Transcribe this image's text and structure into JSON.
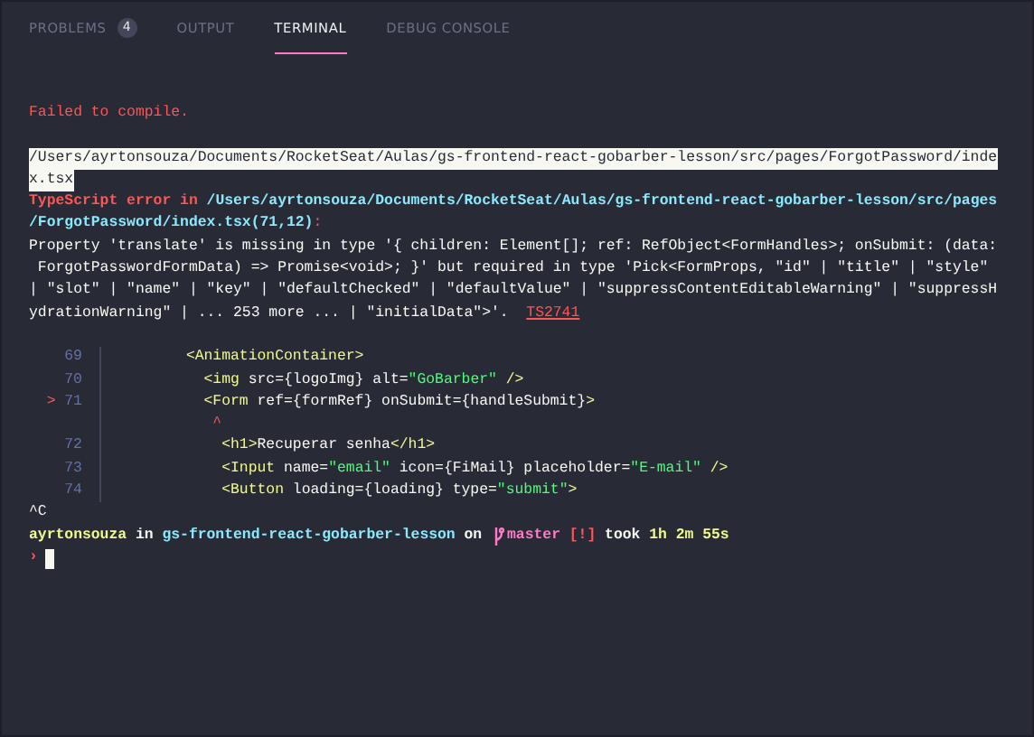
{
  "tabs": [
    {
      "label": "PROBLEMS",
      "badge": "4",
      "selected": false
    },
    {
      "label": "OUTPUT",
      "selected": false
    },
    {
      "label": "TERMINAL",
      "selected": true
    },
    {
      "label": "DEBUG CONSOLE",
      "selected": false
    }
  ],
  "terminal": {
    "lines": [
      {
        "kind": "text",
        "selected": false,
        "segments": [
          {
            "kind": "error",
            "text": "Failed to compile."
          }
        ]
      },
      {
        "kind": "blank"
      },
      {
        "kind": "text",
        "selected": true,
        "segments": [
          {
            "kind": "plain",
            "text": "/Users/ayrtonsouza/Documents/RocketSeat/Aulas/gs-frontend-react-gobarber-lesson/src/pages/ForgotPassword/inde"
          }
        ]
      },
      {
        "kind": "text",
        "selected": true,
        "segments": [
          {
            "kind": "plain",
            "text": "x.tsx"
          }
        ]
      },
      {
        "kind": "text",
        "selected": false,
        "segments": [
          {
            "kind": "error-bold",
            "text": "TypeScript error in "
          },
          {
            "kind": "path",
            "text": "/Users/ayrtonsouza/Documents/RocketSeat/Aulas/gs-frontend-react-gobarber-lesson/src/pages"
          }
        ]
      },
      {
        "kind": "text",
        "selected": false,
        "segments": [
          {
            "kind": "path",
            "text": "/ForgotPassword/index.tsx(71,12)"
          },
          {
            "kind": "error",
            "text": ":"
          }
        ]
      },
      {
        "kind": "text",
        "selected": false,
        "segments": [
          {
            "kind": "plain",
            "text": "Property 'translate' is missing in type '{ children: Element[]; ref: RefObject<FormHandles>; onSubmit: (data:"
          }
        ]
      },
      {
        "kind": "text",
        "selected": false,
        "segments": [
          {
            "kind": "plain",
            "text": " ForgotPasswordFormData) => Promise<void>; }' but required in type 'Pick<FormProps, \"id\" | \"title\" | \"style\""
          }
        ]
      },
      {
        "kind": "text",
        "selected": false,
        "segments": [
          {
            "kind": "plain",
            "text": "| \"slot\" | \"name\" | \"key\" | \"defaultChecked\" | \"defaultValue\" | \"suppressContentEditableWarning\" | \"suppressH"
          }
        ]
      },
      {
        "kind": "text",
        "selected": false,
        "segments": [
          {
            "kind": "plain",
            "text": "ydrationWarning\" | ... 253 more ... | \"initialData\">'.  "
          },
          {
            "kind": "code-ref",
            "text": "TS2741"
          }
        ]
      },
      {
        "kind": "blank"
      },
      {
        "kind": "code",
        "number": "69",
        "segments": [
          {
            "kind": "tag",
            "text": "        <AnimationContainer>"
          }
        ]
      },
      {
        "kind": "code",
        "number": "70",
        "segments": [
          {
            "kind": "tag",
            "text": "          <img"
          },
          {
            "kind": "plain",
            "text": " src={logoImg} alt="
          },
          {
            "kind": "string",
            "text": "\"GoBarber\""
          },
          {
            "kind": "tag",
            "text": " />"
          }
        ]
      },
      {
        "kind": "code",
        "marker": ">",
        "number": "71",
        "segments": [
          {
            "kind": "tag",
            "text": "          <Form"
          },
          {
            "kind": "plain",
            "text": " ref={formRef} onSubmit={handleSubmit}"
          },
          {
            "kind": "tag",
            "text": ">"
          }
        ]
      },
      {
        "kind": "code",
        "segments": [
          {
            "kind": "error",
            "text": "           ^"
          }
        ]
      },
      {
        "kind": "code",
        "number": "72",
        "segments": [
          {
            "kind": "tag",
            "text": "            <h1>"
          },
          {
            "kind": "plain",
            "text": "Recuperar senha"
          },
          {
            "kind": "tag",
            "text": "</h1>"
          }
        ]
      },
      {
        "kind": "code",
        "number": "73",
        "segments": [
          {
            "kind": "tag",
            "text": "            <Input"
          },
          {
            "kind": "plain",
            "text": " name="
          },
          {
            "kind": "string",
            "text": "\"email\""
          },
          {
            "kind": "plain",
            "text": " icon={FiMail} placeholder="
          },
          {
            "kind": "string",
            "text": "\"E-mail\""
          },
          {
            "kind": "tag",
            "text": " />"
          }
        ]
      },
      {
        "kind": "code",
        "number": "74",
        "segments": [
          {
            "kind": "tag",
            "text": "            <Button"
          },
          {
            "kind": "plain",
            "text": " loading={loading} type="
          },
          {
            "kind": "string",
            "text": "\"submit\""
          },
          {
            "kind": "tag",
            "text": ">"
          }
        ]
      },
      {
        "kind": "text",
        "selected": false,
        "segments": [
          {
            "kind": "plain",
            "text": "^C"
          }
        ]
      },
      {
        "kind": "prompt",
        "before": [
          {
            "kind": "user",
            "text": "ayrtonsouza"
          },
          {
            "kind": "bold",
            "text": " in "
          },
          {
            "kind": "dir",
            "text": "gs-frontend-react-gobarber-lesson"
          },
          {
            "kind": "bold",
            "text": " on "
          }
        ],
        "after": [
          {
            "kind": "branch",
            "text": "master"
          },
          {
            "kind": "error-bold",
            "text": " [!]"
          },
          {
            "kind": "bold",
            "text": " took "
          },
          {
            "kind": "user",
            "text": "1h 2m 55s"
          }
        ]
      },
      {
        "kind": "input",
        "symbol": "›"
      }
    ]
  }
}
